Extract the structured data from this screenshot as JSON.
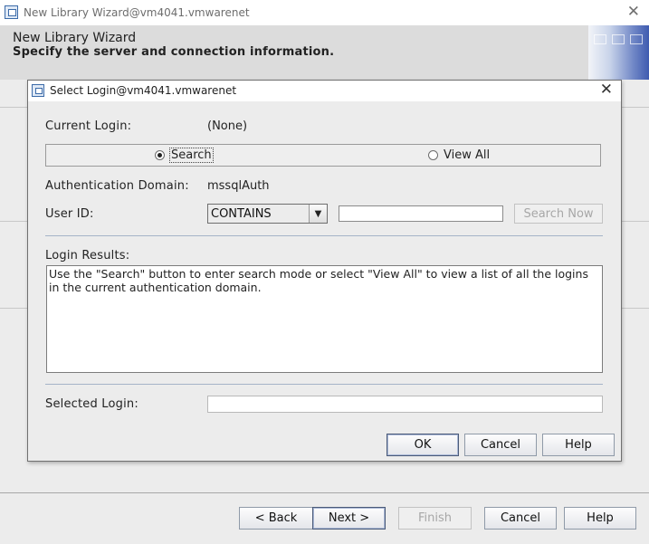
{
  "outer_window": {
    "title": "New Library Wizard@vm4041.vmwarenet",
    "header_title": "New Library Wizard",
    "header_subtitle": "Specify the server and connection information.",
    "buttons": {
      "back": "< Back",
      "next": "Next >",
      "finish": "Finish",
      "cancel": "Cancel",
      "help": "Help"
    }
  },
  "dialog": {
    "title": "Select Login@vm4041.vmwarenet",
    "current_login_label": "Current Login:",
    "current_login_value": "(None)",
    "mode_options": [
      {
        "label": "Search",
        "selected": true
      },
      {
        "label": "View All",
        "selected": false
      }
    ],
    "auth_domain_label": "Authentication Domain:",
    "auth_domain_value": "mssqlAuth",
    "user_id_label": "User ID:",
    "user_id_operator": "CONTAINS",
    "user_id_value": "",
    "search_now_button": "Search Now",
    "login_results_label": "Login Results:",
    "login_results_text": "Use the \"Search\" button to enter search mode or select \"View All\" to view a list of all the logins in the current authentication domain.",
    "selected_login_label": "Selected Login:",
    "selected_login_value": "",
    "buttons": {
      "ok": "OK",
      "cancel": "Cancel",
      "help": "Help"
    }
  }
}
